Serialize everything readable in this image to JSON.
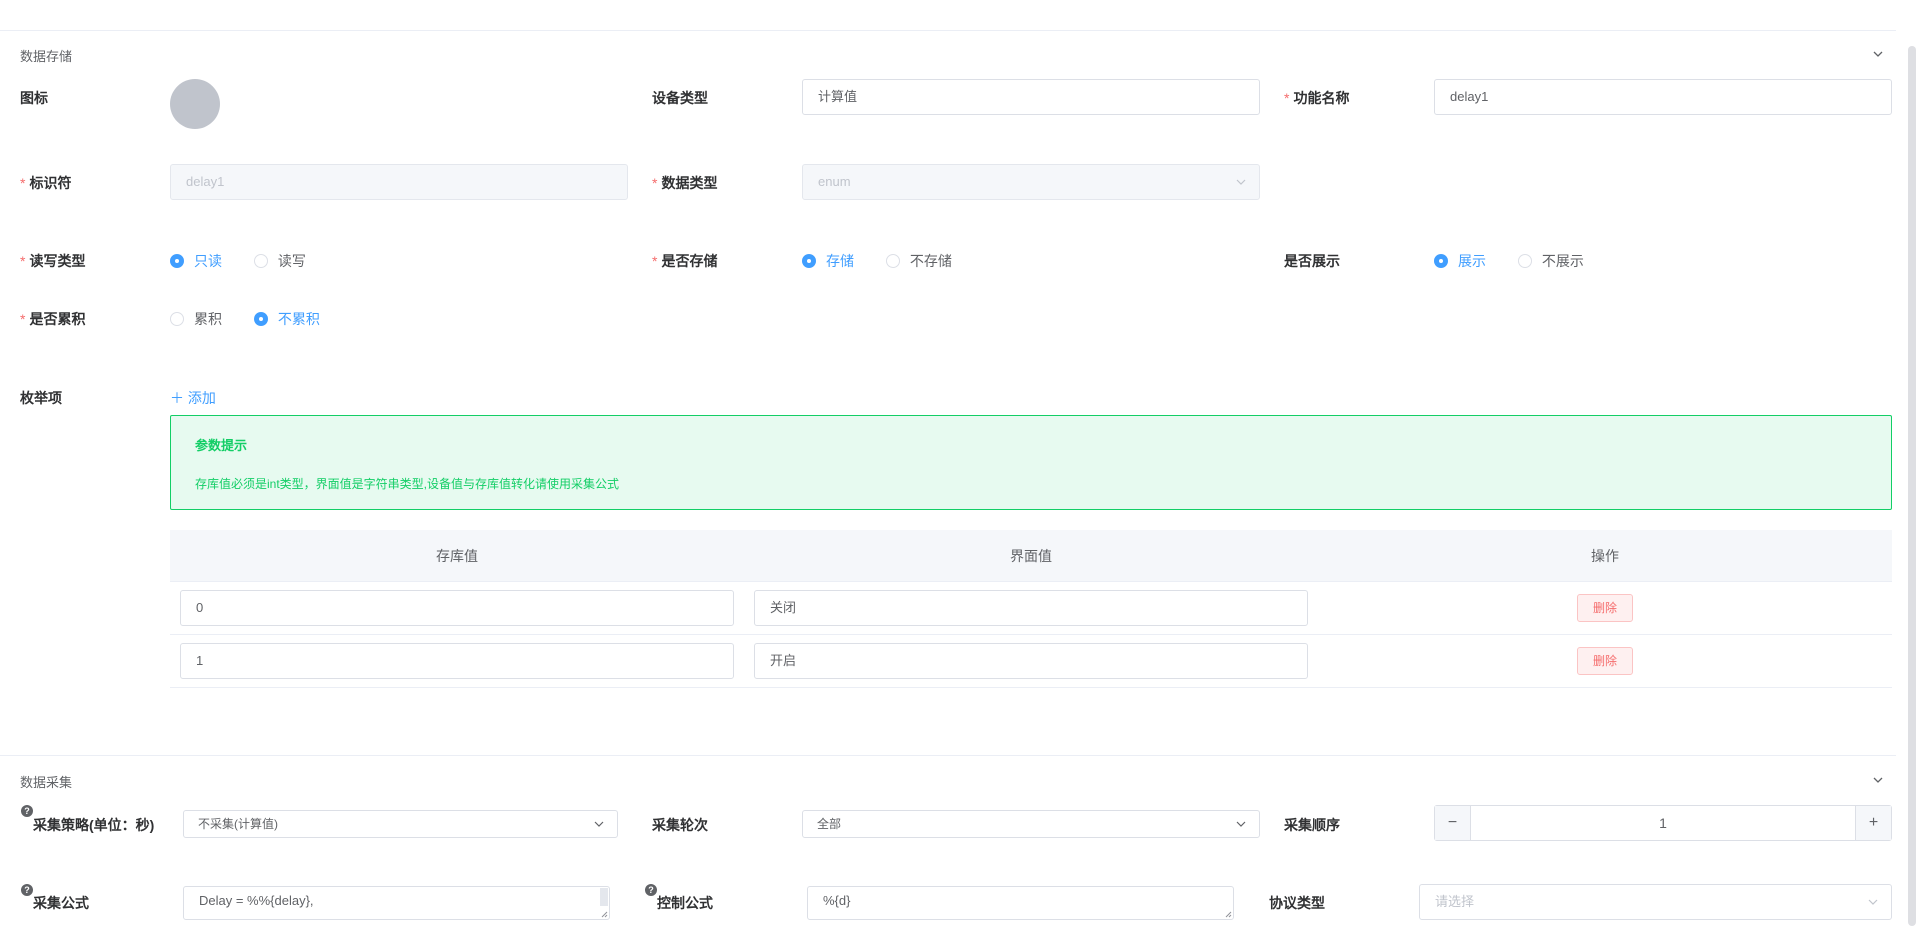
{
  "storage_section": {
    "title": "数据存储",
    "icon_label": "图标",
    "device_type": {
      "label": "设备类型",
      "value": "计算值"
    },
    "function_name": {
      "required": "*",
      "label": "功能名称",
      "value": "delay1"
    },
    "identifier": {
      "required": "*",
      "label": "标识符",
      "value": "delay1"
    },
    "data_type": {
      "required": "*",
      "label": "数据类型",
      "value": "enum"
    },
    "rw_type": {
      "required": "*",
      "label": "读写类型",
      "options": [
        "只读",
        "读写"
      ],
      "selected": "只读"
    },
    "is_store": {
      "required": "*",
      "label": "是否存储",
      "options": [
        "存储",
        "不存储"
      ],
      "selected": "存储"
    },
    "is_show": {
      "label": "是否展示",
      "options": [
        "展示",
        "不展示"
      ],
      "selected": "展示"
    },
    "is_accumulate": {
      "required": "*",
      "label": "是否累积",
      "options": [
        "累积",
        "不累积"
      ],
      "selected": "不累积"
    },
    "enum_label": "枚举项",
    "add_label": "添加",
    "alert": {
      "title": "参数提示",
      "desc": "存库值必须是int类型，界面值是字符串类型,设备值与存库值转化请使用采集公式"
    },
    "table": {
      "headers": [
        "存库值",
        "界面值",
        "操作"
      ],
      "rows": [
        {
          "store": "0",
          "display": "关闭",
          "action": "删除"
        },
        {
          "store": "1",
          "display": "开启",
          "action": "删除"
        }
      ]
    }
  },
  "collect_section": {
    "title": "数据采集",
    "strategy": {
      "label": "采集策略(单位：秒)",
      "value": "不采集(计算值)"
    },
    "rounds": {
      "label": "采集轮次",
      "value": "全部"
    },
    "order": {
      "label": "采集顺序",
      "value": "1",
      "minus": "−",
      "plus": "+"
    },
    "formula": {
      "label": "采集公式",
      "value": "Delay = %%{delay},"
    },
    "control_formula": {
      "label": "控制公式",
      "value": "%{d}"
    },
    "protocol": {
      "label": "协议类型",
      "placeholder": "请选择"
    }
  },
  "colors": {
    "primary": "#409eff",
    "danger": "#f56c6c",
    "success": "#13ce66"
  }
}
